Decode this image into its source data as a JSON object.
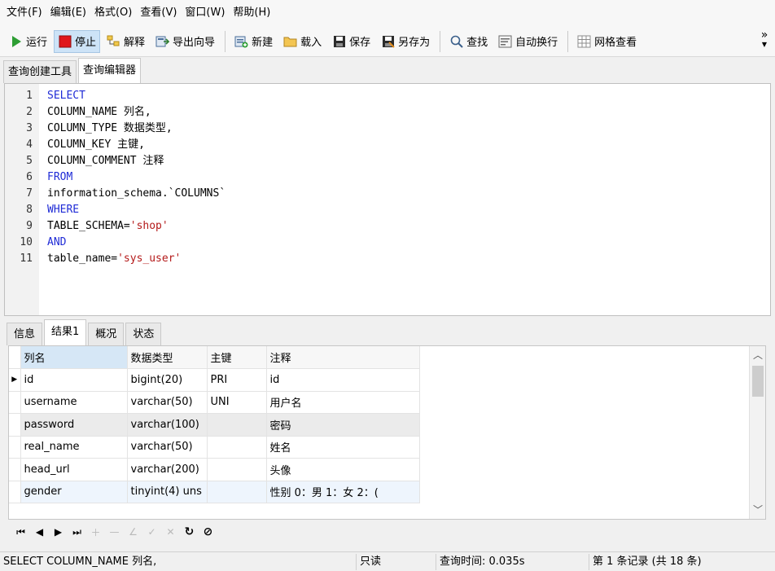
{
  "menu": [
    "文件(F)",
    "编辑(E)",
    "格式(O)",
    "查看(V)",
    "窗口(W)",
    "帮助(H)"
  ],
  "toolbar": {
    "run": "运行",
    "stop": "停止",
    "explain": "解释",
    "export_wizard": "导出向导",
    "new": "新建",
    "load": "载入",
    "save": "保存",
    "save_as": "另存为",
    "find": "查找",
    "word_wrap": "自动换行",
    "grid_view": "网格查看",
    "overflow": "»"
  },
  "editor_tabs": [
    "查询创建工具",
    "查询编辑器"
  ],
  "sql_lines": [
    "SELECT",
    "COLUMN_NAME 列名,",
    "COLUMN_TYPE 数据类型,",
    "COLUMN_KEY 主键,",
    "COLUMN_COMMENT 注释",
    "FROM",
    "information_schema.`COLUMNS`",
    "WHERE",
    "TABLE_SCHEMA='shop'",
    "AND",
    "table_name='sys_user'"
  ],
  "sql_line_numbers": [
    "1",
    "2",
    "3",
    "4",
    "5",
    "6",
    "7",
    "8",
    "9",
    "10",
    "11"
  ],
  "result_tabs": [
    "信息",
    "结果1",
    "概况",
    "状态"
  ],
  "grid": {
    "columns": [
      "列名",
      "数据类型",
      "主键",
      "注释"
    ],
    "rows": [
      [
        "id",
        "bigint(20)",
        "PRI",
        "id"
      ],
      [
        "username",
        "varchar(50)",
        "UNI",
        "用户名"
      ],
      [
        "password",
        "varchar(100)",
        "",
        "密码"
      ],
      [
        "real_name",
        "varchar(50)",
        "",
        "姓名"
      ],
      [
        "head_url",
        "varchar(200)",
        "",
        "头像"
      ],
      [
        "gender",
        "tinyint(4) uns",
        "",
        "性别   0：男   1：女    2：("
      ]
    ],
    "current_row_marker": "▶"
  },
  "status": {
    "sql": "SELECT COLUMN_NAME 列名,",
    "readonly": "只读",
    "query_time": "查询时间: 0.035s",
    "record_info": "第 1 条记录 (共 18 条)"
  }
}
